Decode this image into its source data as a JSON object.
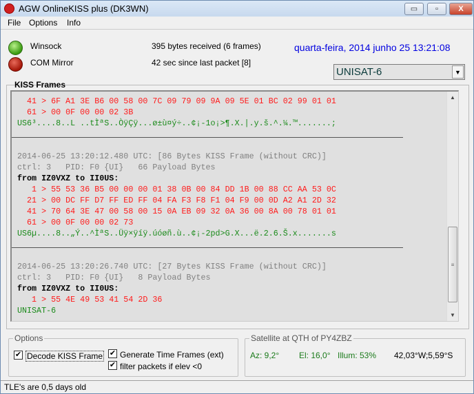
{
  "window": {
    "title": "AGW OnlineKISS plus (DK3WN)",
    "minimize": "▭",
    "maximize": "▫",
    "close": "X"
  },
  "menu": [
    "File",
    "Options",
    "Info"
  ],
  "status": {
    "winsock_label": "Winsock",
    "com_label": "COM Mirror",
    "bytes_received": "395 bytes received (6 frames)",
    "since_last": "42 sec since last packet [8]",
    "datetime": "quarta-feira, 2014 junho 25  13:21:08"
  },
  "satellite_select": {
    "value": "UNISAT-6"
  },
  "kiss": {
    "label": "KISS Frames",
    "lines": [
      {
        "t": "hex",
        "c": "  41 > 6F A1 3E B6 00 58 00 7C 09 79 09 9A 09 5E 01 BC 02 99 01 01"
      },
      {
        "t": "hex",
        "c": "  61 > 00 0F 00 00 02 3B"
      },
      {
        "t": "ascii",
        "c": "US6³....8..L ..tÌªS..ÒÿÇÿ...ø±ù¤ý÷..¢¡-1o¡>¶.X.|.y.š.^.¼.™.......;"
      },
      {
        "t": "blank",
        "c": ""
      },
      {
        "t": "rule",
        "c": ""
      },
      {
        "t": "meta",
        "c": "2014-06-25 13:20:12.480 UTC: [86 Bytes KISS Frame (without CRC)]"
      },
      {
        "t": "meta",
        "c": "ctrl: 3   PID: F0 {UI}   66 Payload Bytes"
      },
      {
        "t": "from",
        "c": "from IZ0VXZ to II0US:"
      },
      {
        "t": "hex",
        "c": "   1 > 55 53 36 B5 00 00 00 01 38 0B 00 84 DD 1B 00 88 CC AA 53 0C"
      },
      {
        "t": "hex",
        "c": "  21 > 00 DC FF D7 FF ED FF 04 FA F3 F8 F1 04 F9 00 0D A2 A1 2D 32"
      },
      {
        "t": "hex",
        "c": "  41 > 70 64 3E 47 00 58 00 15 0A EB 09 32 0A 36 00 8A 00 78 01 01"
      },
      {
        "t": "hex",
        "c": "  61 > 00 0F 00 00 02 73"
      },
      {
        "t": "ascii",
        "c": "US6µ....8..„Ý..^ÌªS..Üÿ×ÿíÿ.úóøñ.ù..¢¡-2pd>G.X...ë.2.6.Š.x.......s"
      },
      {
        "t": "blank",
        "c": ""
      },
      {
        "t": "rule",
        "c": ""
      },
      {
        "t": "meta",
        "c": "2014-06-25 13:20:26.740 UTC: [27 Bytes KISS Frame (without CRC)]"
      },
      {
        "t": "meta",
        "c": "ctrl: 3   PID: F0 {UI}   8 Payload Bytes"
      },
      {
        "t": "from",
        "c": "from IZ0VXZ to II0US:"
      },
      {
        "t": "hex",
        "c": "   1 > 55 4E 49 53 41 54 2D 36"
      },
      {
        "t": "ascii",
        "c": "UNISAT-6"
      }
    ]
  },
  "options": {
    "label": "Options",
    "decode": "Decode KISS Frame",
    "generate": "Generate Time Frames (ext)",
    "filter": "filter packets if elev <0",
    "decode_checked": true,
    "generate_checked": true,
    "filter_checked": true
  },
  "satellite": {
    "label": "Satellite at QTH of PY4ZBZ",
    "az": "Az: 9,2°",
    "el": "El: 16,0°",
    "illum": "Illum: 53%",
    "position": "42,03°W;5,59°S"
  },
  "statusbar": "TLE's are 0,5 days old"
}
